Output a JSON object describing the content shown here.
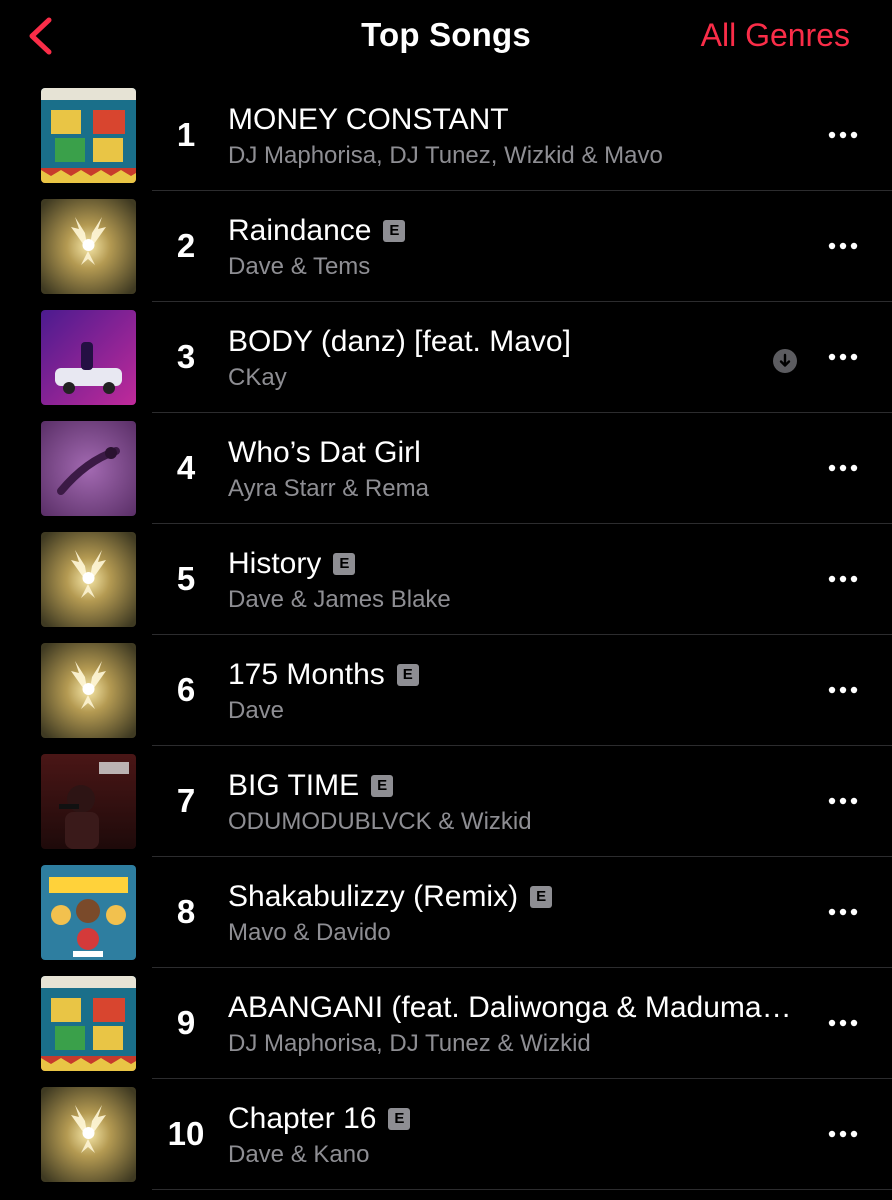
{
  "header": {
    "title": "Top Songs",
    "back_icon": "chevron-left-icon",
    "genres_label": "All Genres",
    "accent_color": "#fa2d48"
  },
  "songs": [
    {
      "rank": "1",
      "title": "MONEY CONSTANT",
      "artist": "DJ Maphorisa, DJ Tunez, Wizkid & Mavo",
      "explicit": false,
      "downloaded": false,
      "art": "south-side"
    },
    {
      "rank": "2",
      "title": "Raindance",
      "artist": "Dave & Tems",
      "explicit": true,
      "downloaded": false,
      "art": "golden-wings"
    },
    {
      "rank": "3",
      "title": "BODY (danz) [feat. Mavo]",
      "artist": "CKay",
      "explicit": false,
      "downloaded": true,
      "art": "body"
    },
    {
      "rank": "4",
      "title": "Who’s Dat Girl",
      "artist": "Ayra Starr & Rema",
      "explicit": false,
      "downloaded": false,
      "art": "purple"
    },
    {
      "rank": "5",
      "title": "History",
      "artist": "Dave & James Blake",
      "explicit": true,
      "downloaded": false,
      "art": "golden-wings"
    },
    {
      "rank": "6",
      "title": "175 Months",
      "artist": "Dave",
      "explicit": true,
      "downloaded": false,
      "art": "golden-wings"
    },
    {
      "rank": "7",
      "title": "BIG TIME",
      "artist": "ODUMODUBLVCK & Wizkid",
      "explicit": true,
      "downloaded": false,
      "art": "big-time"
    },
    {
      "rank": "8",
      "title": "Shakabulizzy (Remix)",
      "artist": "Mavo & Davido",
      "explicit": true,
      "downloaded": false,
      "art": "shakabulizzy"
    },
    {
      "rank": "9",
      "title": "ABANGANI (feat. Daliwonga & Madumane)",
      "artist": "DJ Maphorisa, DJ Tunez & Wizkid",
      "explicit": false,
      "downloaded": false,
      "art": "south-side"
    },
    {
      "rank": "10",
      "title": "Chapter 16",
      "artist": "Dave & Kano",
      "explicit": true,
      "downloaded": false,
      "art": "golden-wings"
    }
  ],
  "labels": {
    "explicit_badge": "E"
  },
  "icons": {
    "more": "more-icon",
    "download": "download-icon"
  }
}
